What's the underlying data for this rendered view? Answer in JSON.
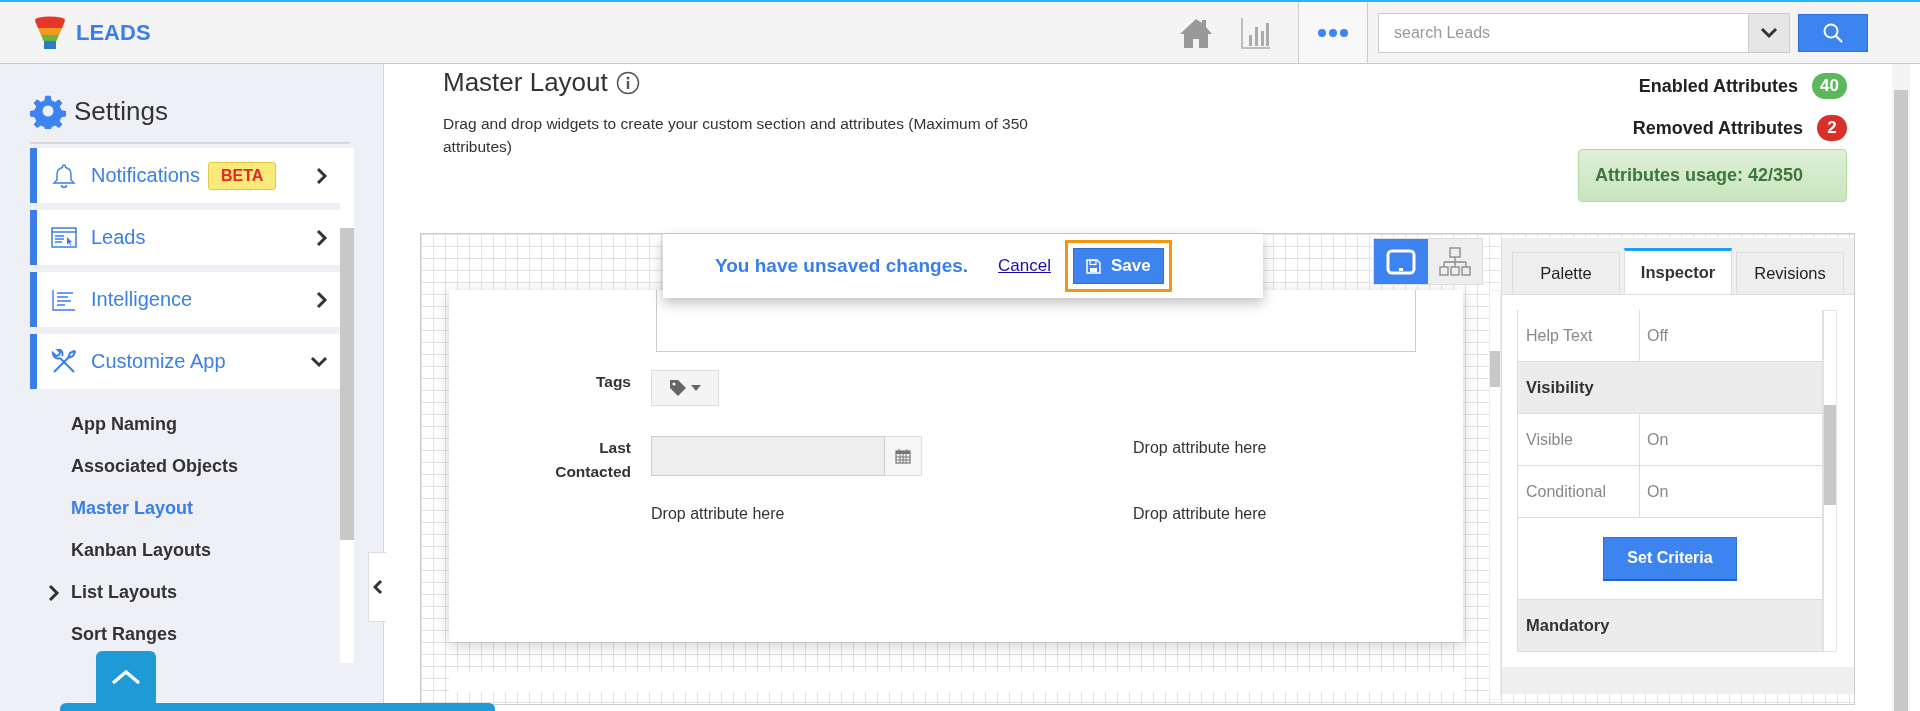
{
  "app": {
    "name": "LEADS"
  },
  "header": {
    "search": {
      "placeholder": "search Leads"
    }
  },
  "sidebar": {
    "title": "Settings",
    "items": [
      {
        "kind": "bell",
        "label": "Notifications",
        "badge": "BETA",
        "expanded": false
      },
      {
        "kind": "window",
        "label": "Leads",
        "expanded": false
      },
      {
        "kind": "lines",
        "label": "Intelligence",
        "expanded": false
      },
      {
        "kind": "tools",
        "label": "Customize App",
        "expanded": true
      }
    ],
    "sub_items": [
      {
        "label": "App Naming",
        "selected": false,
        "has_children": false
      },
      {
        "label": "Associated Objects",
        "selected": false,
        "has_children": false
      },
      {
        "label": "Master Layout",
        "selected": true,
        "has_children": false
      },
      {
        "label": "Kanban Layouts",
        "selected": false,
        "has_children": false
      },
      {
        "label": "List Layouts",
        "selected": false,
        "has_children": true
      },
      {
        "label": "Sort Ranges",
        "selected": false,
        "has_children": false
      }
    ]
  },
  "page": {
    "title": "Master Layout",
    "description": "Drag and drop widgets to create your custom section and attributes (Maximum of 350 attributes)"
  },
  "stats": [
    {
      "label": "Enabled Attributes",
      "count": "40",
      "color": "#5cb85c"
    },
    {
      "label": "Removed Attributes",
      "count": "2",
      "color": "#d9302c"
    }
  ],
  "usage": "Attributes usage: 42/350",
  "unsaved": {
    "message": "You have unsaved changes.",
    "cancel": "Cancel",
    "save": "Save"
  },
  "view_modes": [
    {
      "kind": "desktop",
      "selected": true
    },
    {
      "kind": "hierarchy",
      "selected": false
    }
  ],
  "form": {
    "rows": [
      [
        {
          "kind": "tags",
          "label": "Tags"
        }
      ],
      [
        {
          "kind": "date",
          "label": "Last Contacted"
        },
        {
          "kind": "drop",
          "text": "Drop attribute here"
        }
      ],
      [
        {
          "kind": "drop",
          "text": "Drop attribute here"
        },
        {
          "kind": "drop",
          "text": "Drop attribute here"
        }
      ]
    ]
  },
  "panel": {
    "tabs": [
      {
        "label": "Palette",
        "selected": false
      },
      {
        "label": "Inspector",
        "selected": true
      },
      {
        "label": "Revisions",
        "selected": false
      }
    ],
    "rows": [
      {
        "kind": "property",
        "label": "Help Text",
        "value": "Off"
      },
      {
        "kind": "section",
        "label": "Visibility"
      },
      {
        "kind": "property",
        "label": "Visible",
        "value": "On"
      },
      {
        "kind": "property",
        "label": "Conditional",
        "value": "On"
      },
      {
        "kind": "action",
        "label": "Set Criteria"
      },
      {
        "kind": "section",
        "label": "Mandatory"
      }
    ]
  }
}
